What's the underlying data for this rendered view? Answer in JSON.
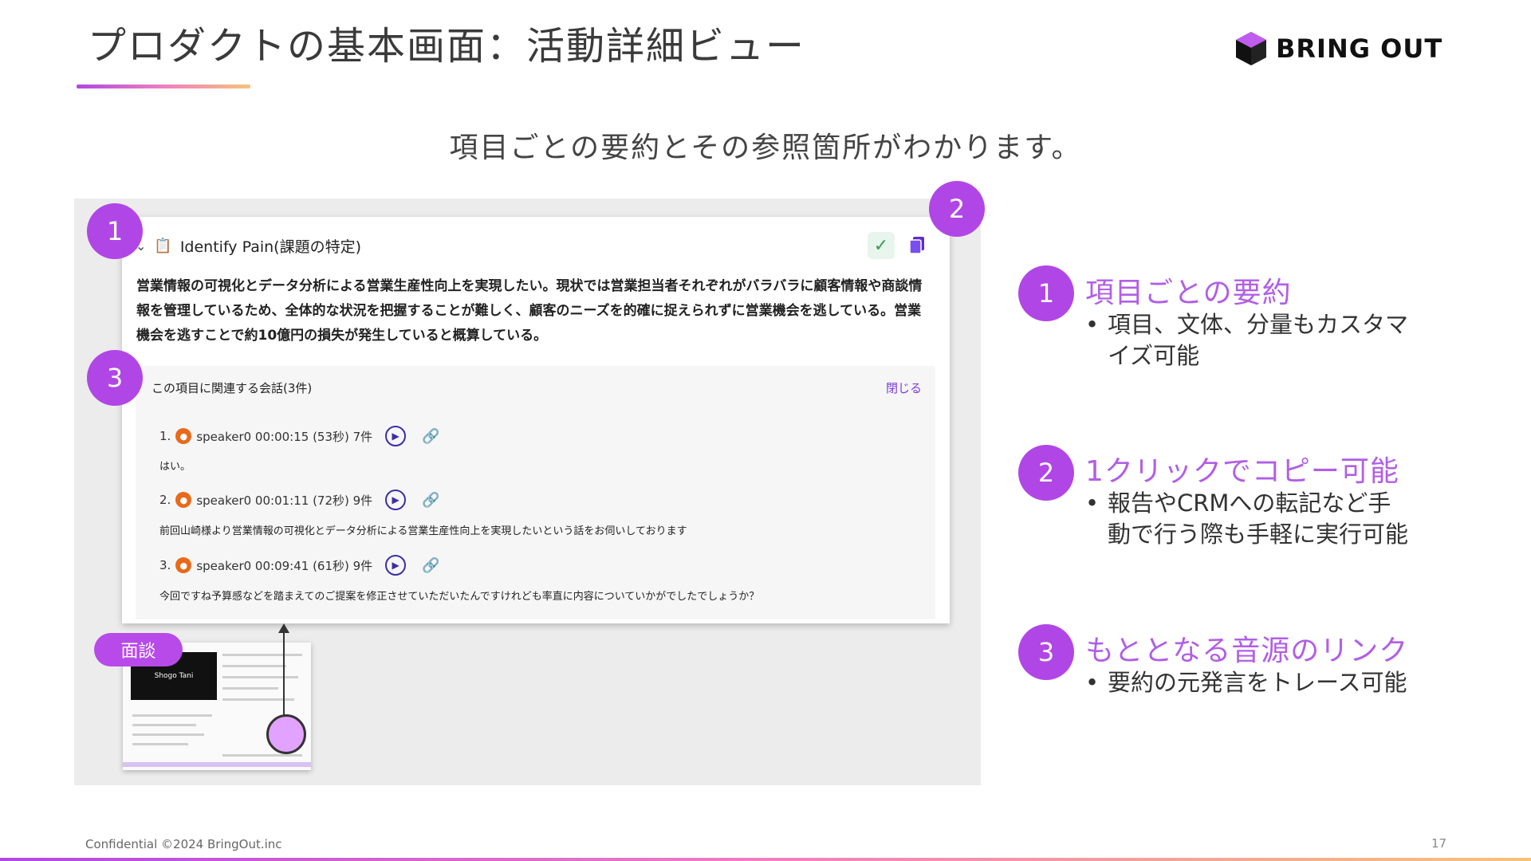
{
  "header": {
    "title": "プロダクトの基本画面：活動詳細ビュー",
    "logo_text": "BRING OUT"
  },
  "subtitle": "項目ごとの要約とその参照箇所がわかります。",
  "screenshot": {
    "item_title": "Identify Pain(課題の特定)",
    "summary": "営業情報の可視化とデータ分析による営業生産性向上を実現したい。現状では営業担当者それぞれがバラバラに顧客情報や商談情報を管理しているため、全体的な状況を把握することが難しく、顧客のニーズを的確に捉えられずに営業機会を逃している。営業機会を逃すことで約10億円の損失が発生していると概算している。",
    "related_title": "この項目に関連する会話(3件)",
    "close_label": "閉じる",
    "conversations": [
      {
        "index": "1.",
        "meta": "speaker0 00:00:15 (53秒) 7件",
        "text": "はい。"
      },
      {
        "index": "2.",
        "meta": "speaker0 00:01:11 (72秒) 9件",
        "text": "前回山崎様より営業情報の可視化とデータ分析による営業生産性向上を実現したいという話をお伺いしております"
      },
      {
        "index": "3.",
        "meta": "speaker0 00:09:41 (61秒) 9件",
        "text": "今回ですね予算感などを踏まえてのご提案を修正させていただいたんですけれども率直に内容についていかがでしたでしょうか？"
      }
    ],
    "thumbnail_name": "Shogo Tani",
    "interview_label": "面談"
  },
  "badges": {
    "b1": "1",
    "b2": "2",
    "b3": "3"
  },
  "features": [
    {
      "num": "1",
      "title": "項目ごとの要約",
      "bullet_lines": [
        "項目、文体、分量もカスタマ",
        "イズ可能"
      ]
    },
    {
      "num": "2",
      "title": "1クリックでコピー可能",
      "bullet_lines": [
        "報告やCRMへの転記など手",
        "動で行う際も手軽に実行可能"
      ]
    },
    {
      "num": "3",
      "title": "もととなる音源のリンク",
      "bullet_lines": [
        "要約の元発言をトレース可能"
      ]
    }
  ],
  "footer": {
    "confidential": "Confidential ©2024 BringOut.inc",
    "page": "17"
  },
  "colors": {
    "accent": "#b146e6",
    "feature_title": "#b15fe6",
    "play_icon": "#3b2ea8"
  }
}
